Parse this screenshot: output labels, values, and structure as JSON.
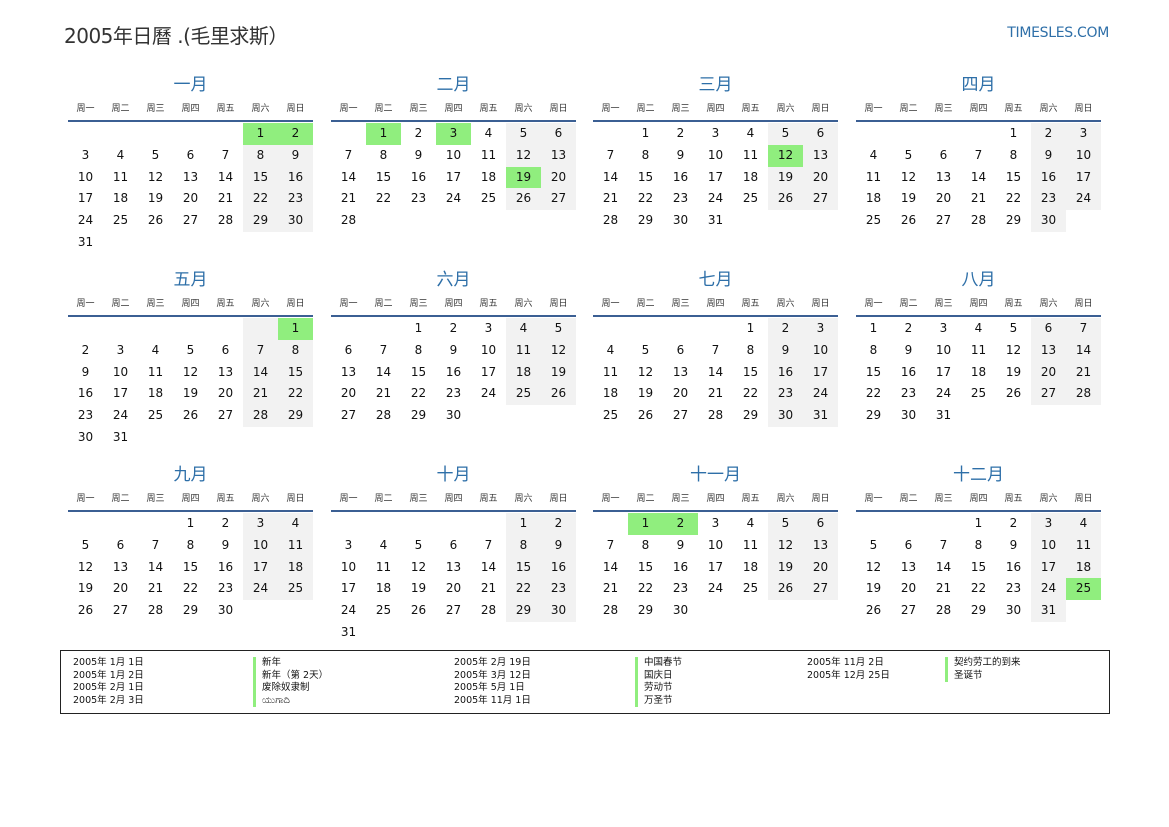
{
  "header": {
    "title": "2005年日曆 .(毛里求斯）",
    "site": "TIMESLES.COM"
  },
  "weekdays": [
    "周一",
    "周二",
    "周三",
    "周四",
    "周五",
    "周六",
    "周日"
  ],
  "months": [
    {
      "name": "一月",
      "offset": 5,
      "days": 31,
      "holidays": [
        1,
        2
      ]
    },
    {
      "name": "二月",
      "offset": 1,
      "days": 28,
      "holidays": [
        1,
        3,
        19
      ]
    },
    {
      "name": "三月",
      "offset": 1,
      "days": 31,
      "holidays": [
        12
      ]
    },
    {
      "name": "四月",
      "offset": 4,
      "days": 30,
      "holidays": []
    },
    {
      "name": "五月",
      "offset": 6,
      "days": 31,
      "holidays": [
        1
      ]
    },
    {
      "name": "六月",
      "offset": 2,
      "days": 30,
      "holidays": []
    },
    {
      "name": "七月",
      "offset": 4,
      "days": 31,
      "holidays": []
    },
    {
      "name": "八月",
      "offset": 0,
      "days": 31,
      "holidays": []
    },
    {
      "name": "九月",
      "offset": 3,
      "days": 30,
      "holidays": []
    },
    {
      "name": "十月",
      "offset": 5,
      "days": 31,
      "holidays": []
    },
    {
      "name": "十一月",
      "offset": 1,
      "days": 30,
      "holidays": [
        1,
        2
      ]
    },
    {
      "name": "十二月",
      "offset": 3,
      "days": 31,
      "holidays": [
        25
      ]
    }
  ],
  "legend": {
    "col1_dates": [
      "2005年 1月 1日",
      "2005年 1月 2日",
      "2005年 2月 1日",
      "2005年 2月 3日"
    ],
    "col1_names": [
      "新年",
      "新年（第 2天）",
      "废除奴隶制",
      "ಯುಗಾದಿ"
    ],
    "col2_dates": [
      "2005年 2月 19日",
      "2005年 3月 12日",
      "2005年 5月 1日",
      "2005年 11月 1日"
    ],
    "col2_names": [
      "中国春节",
      "国庆日",
      "劳动节",
      "万圣节"
    ],
    "col3_dates": [
      "2005年 11月 2日",
      "2005年 12月 25日"
    ],
    "col3_names": [
      "契约劳工的到来",
      "圣诞节"
    ]
  },
  "colors": {
    "holiday": "#90ee7e",
    "weekend": "#f2f2f2",
    "accent": "#2e6fa8",
    "rule": "#3b5f93"
  }
}
